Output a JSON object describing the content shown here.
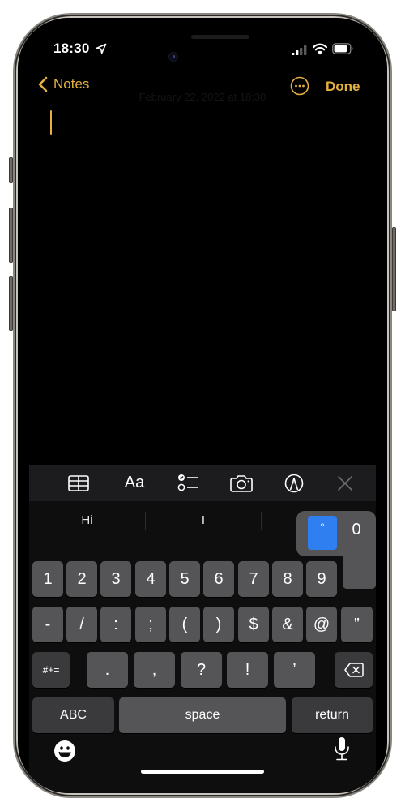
{
  "status_bar": {
    "time": "18:30",
    "location_icon": "location-arrow-icon",
    "signal_bars_active": 2,
    "signal_bars_total": 4,
    "wifi_icon": "wifi-icon",
    "battery_level_percent": 85
  },
  "nav": {
    "back_label": "Notes",
    "more_icon": "ellipsis-circle-icon",
    "done_label": "Done",
    "accent_color": "#e4b13f"
  },
  "note": {
    "date_text": "February 22, 2022 at 18:30",
    "body": ""
  },
  "toolbar": {
    "items": [
      {
        "name": "table",
        "icon": "table-icon"
      },
      {
        "name": "format",
        "label": "Aa",
        "icon": "text-format-icon"
      },
      {
        "name": "checklist",
        "icon": "checklist-icon"
      },
      {
        "name": "camera",
        "icon": "camera-icon"
      },
      {
        "name": "markup",
        "icon": "markup-pen-icon"
      },
      {
        "name": "close",
        "icon": "close-icon"
      }
    ]
  },
  "suggestions": [
    "Hi",
    "I",
    ""
  ],
  "keyboard": {
    "row1": [
      "1",
      "2",
      "3",
      "4",
      "5",
      "6",
      "7",
      "8",
      "9",
      "0"
    ],
    "row2": [
      "-",
      "/",
      ":",
      ";",
      "(",
      ")",
      "$",
      "&",
      "@",
      "”"
    ],
    "row3": {
      "shift_label": "#+=",
      "keys": [
        ".",
        ",",
        "?",
        "!",
        "’"
      ],
      "delete_icon": "backspace-icon"
    },
    "row4": {
      "abc_label": "ABC",
      "space_label": "space",
      "return_label": "return"
    },
    "popup": {
      "selected": "°",
      "alternate": "0",
      "selected_color": "#2f7ff0"
    },
    "emoji_icon": "emoji-icon",
    "mic_icon": "microphone-icon"
  }
}
